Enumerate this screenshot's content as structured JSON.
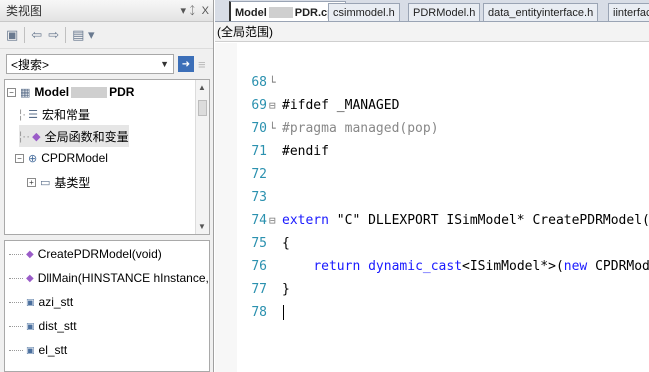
{
  "class_view": {
    "title": "类视图",
    "pin_label": "▾ ᛨ",
    "close_label": "X",
    "search": {
      "value": "<搜索>"
    },
    "tree": [
      {
        "label": "Model",
        "label_suffix": "PDR"
      },
      {
        "label": "宏和常量"
      },
      {
        "label": "全局函数和变量"
      },
      {
        "label": "CPDRModel"
      },
      {
        "label": "基类型"
      }
    ],
    "members": [
      {
        "label": "CreatePDRModel(void)"
      },
      {
        "label": "DllMain(HINSTANCE hInstance, D\\"
      },
      {
        "label": "azi_stt"
      },
      {
        "label": "dist_stt"
      },
      {
        "label": "el_stt"
      }
    ]
  },
  "editor": {
    "tabs": [
      {
        "label_prefix": "Model",
        "label_suffix": "PDR.cpp",
        "active": true
      },
      {
        "label": "csimmodel.h"
      },
      {
        "label": "PDRModel.h"
      },
      {
        "label": "data_entityinterface.h"
      },
      {
        "label": "iinterfac"
      }
    ],
    "scope": "(全局范围)",
    "lines": [
      {
        "num": "68",
        "fold": "└",
        "text": ""
      },
      {
        "num": "69",
        "fold": "⊟",
        "text": "#ifdef _MANAGED"
      },
      {
        "num": "70",
        "fold": "└",
        "text": "#pragma managed(pop)"
      },
      {
        "num": "71",
        "fold": "",
        "text": "#endif"
      },
      {
        "num": "72",
        "fold": "",
        "text": ""
      },
      {
        "num": "73",
        "fold": "",
        "text": ""
      },
      {
        "num": "74",
        "fold": "⊟",
        "text": "extern \"C\" DLLEXPORT ISimModel* CreatePDRModel()"
      },
      {
        "num": "75",
        "fold": "",
        "text": "{"
      },
      {
        "num": "76",
        "fold": "",
        "text": "    return dynamic_cast<ISimModel*>(new CPDRModel);"
      },
      {
        "num": "77",
        "fold": "",
        "text": "}"
      },
      {
        "num": "78",
        "fold": "",
        "text": ""
      }
    ]
  }
}
